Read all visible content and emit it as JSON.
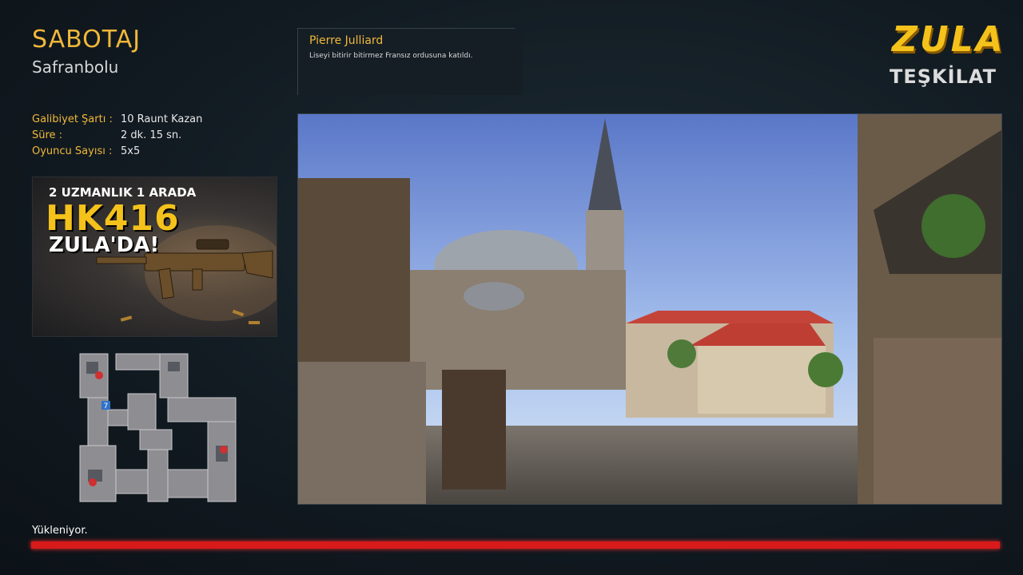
{
  "mode": {
    "title": "SABOTAJ",
    "map_name": "Safranbolu"
  },
  "match_info": [
    {
      "label": "Galibiyet Şartı :",
      "value": "10 Raunt Kazan"
    },
    {
      "label": "Süre :",
      "value": "2 dk. 15 sn."
    },
    {
      "label": "Oyuncu Sayısı :",
      "value": "5x5"
    }
  ],
  "promo": {
    "line1": "2 UZMANLIK 1 ARADA",
    "line2": "HK416",
    "line3": "ZULA'DA!"
  },
  "character": {
    "name": "Pierre Julliard",
    "bio": "Liseyi bitirir bitirmez Fransız ordusuna katıldı."
  },
  "logo": {
    "top": "ZULA",
    "bottom": "TEŞKİLAT"
  },
  "minimap": {
    "markers": [
      "7"
    ]
  },
  "loading": {
    "label": "Yükleniyor.",
    "progress": 1.0
  },
  "colors": {
    "accent": "#f0b83a",
    "progress": "#d81a1a",
    "background": "#121b22"
  }
}
